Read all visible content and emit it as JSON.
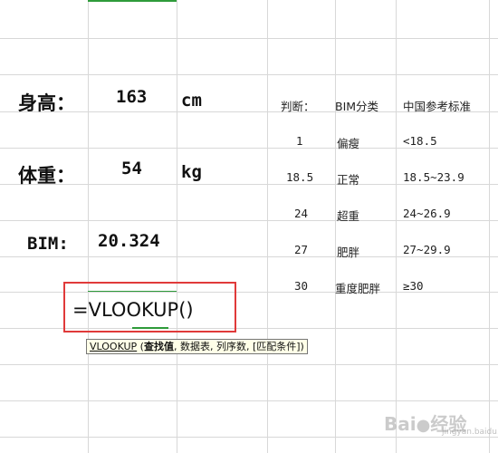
{
  "sheet": {
    "height_label": "身高：",
    "height_value": "163",
    "height_unit": "cm",
    "weight_label": "体重：",
    "weight_value": "54",
    "weight_unit": "kg",
    "bim_label": "BIM:",
    "bim_value": "20.324"
  },
  "bmi_table": {
    "headers": [
      "判断：",
      "BIM分类",
      "中国参考标准"
    ],
    "rows": [
      {
        "threshold": "1",
        "category": "偏瘦",
        "range": "<18.5"
      },
      {
        "threshold": "18.5",
        "category": "正常",
        "range": "18.5~23.9"
      },
      {
        "threshold": "24",
        "category": "超重",
        "range": "24~26.9"
      },
      {
        "threshold": "27",
        "category": "肥胖",
        "range": "27~29.9"
      },
      {
        "threshold": "30",
        "category": "重度肥胖",
        "range": "≥30"
      }
    ]
  },
  "formula": {
    "text": "=VLOOKUP()"
  },
  "tooltip": {
    "fn_name": "VLOOKUP",
    "open": " (",
    "arg1": "查找值",
    "rest": ", 数据表, 列序数, [匹配条件])"
  },
  "watermark": {
    "brand": "Bai",
    "brand2": "经验",
    "sub": "jingyan.baidu.com"
  },
  "colors": {
    "highlight_border": "#e03a3a",
    "active_cell_green": "#2e9b3a",
    "tooltip_bg": "#ffffe8"
  }
}
